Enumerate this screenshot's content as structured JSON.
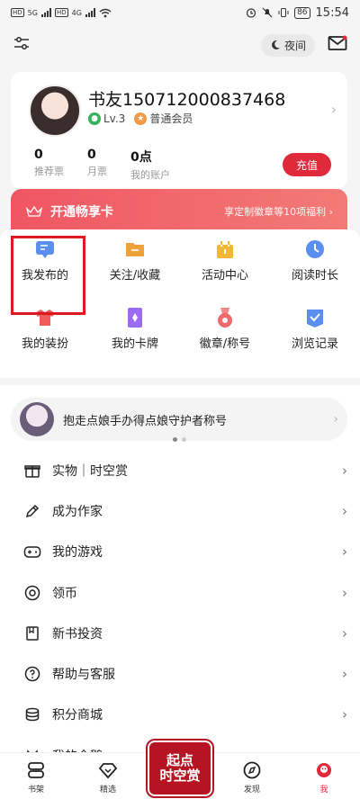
{
  "status_bar": {
    "hd1": "HD",
    "hd2": "HD",
    "net1": "5G",
    "net2": "4G",
    "battery": "86",
    "time": "15:54"
  },
  "top_bar": {
    "night_label": "夜间",
    "icons": [
      "settings-sliders-icon",
      "moon-icon",
      "mail-icon"
    ]
  },
  "profile": {
    "username": "书友150712000837468",
    "level": "Lv.3",
    "member": "普通会员",
    "stats": [
      {
        "num": "0",
        "label": "推荐票"
      },
      {
        "num": "0",
        "label": "月票"
      },
      {
        "num": "0点",
        "label": "我的账户"
      }
    ],
    "recharge": "充值"
  },
  "vip": {
    "title": "开通畅享卡",
    "subtitle": "享定制徽章等10项福利 ›"
  },
  "grid": [
    {
      "label": "我发布的",
      "icon": "post-icon",
      "color": "#5a8ff0"
    },
    {
      "label": "关注/收藏",
      "icon": "folder-icon",
      "color": "#f0a13c"
    },
    {
      "label": "活动中心",
      "icon": "gift-icon",
      "color": "#f2b735"
    },
    {
      "label": "阅读时长",
      "icon": "clock-icon",
      "color": "#5a8ff0"
    },
    {
      "label": "我的装扮",
      "icon": "shirt-icon",
      "color": "#ef5a5a"
    },
    {
      "label": "我的卡牌",
      "icon": "card-icon",
      "color": "#9b6cf0"
    },
    {
      "label": "徽章/称号",
      "icon": "medal-icon",
      "color": "#ef6a6a"
    },
    {
      "label": "浏览记录",
      "icon": "history-icon",
      "color": "#5a8ff0"
    }
  ],
  "promo": {
    "text": "抱走点娘手办得点娘守护者称号"
  },
  "menu": [
    {
      "label": "实物｜时空赏",
      "icon": "gift-box-icon"
    },
    {
      "label": "成为作家",
      "icon": "pen-icon"
    },
    {
      "label": "我的游戏",
      "icon": "gamepad-icon"
    },
    {
      "label": "领币",
      "icon": "coin-icon"
    },
    {
      "label": "新书投资",
      "icon": "book-icon"
    },
    {
      "label": "帮助与客服",
      "icon": "help-icon"
    },
    {
      "label": "积分商城",
      "icon": "points-icon"
    },
    {
      "label": "我的企鹅",
      "icon": "penguin-icon"
    }
  ],
  "bottom_nav": [
    {
      "label": "书架",
      "icon": "bookshelf-icon"
    },
    {
      "label": "精选",
      "icon": "diamond-icon"
    },
    {
      "label": "",
      "icon": "center-logo"
    },
    {
      "label": "发现",
      "icon": "compass-icon"
    },
    {
      "label": "我",
      "icon": "me-icon"
    }
  ],
  "center_logo": {
    "line1": "起点",
    "line2": "时空赏"
  }
}
